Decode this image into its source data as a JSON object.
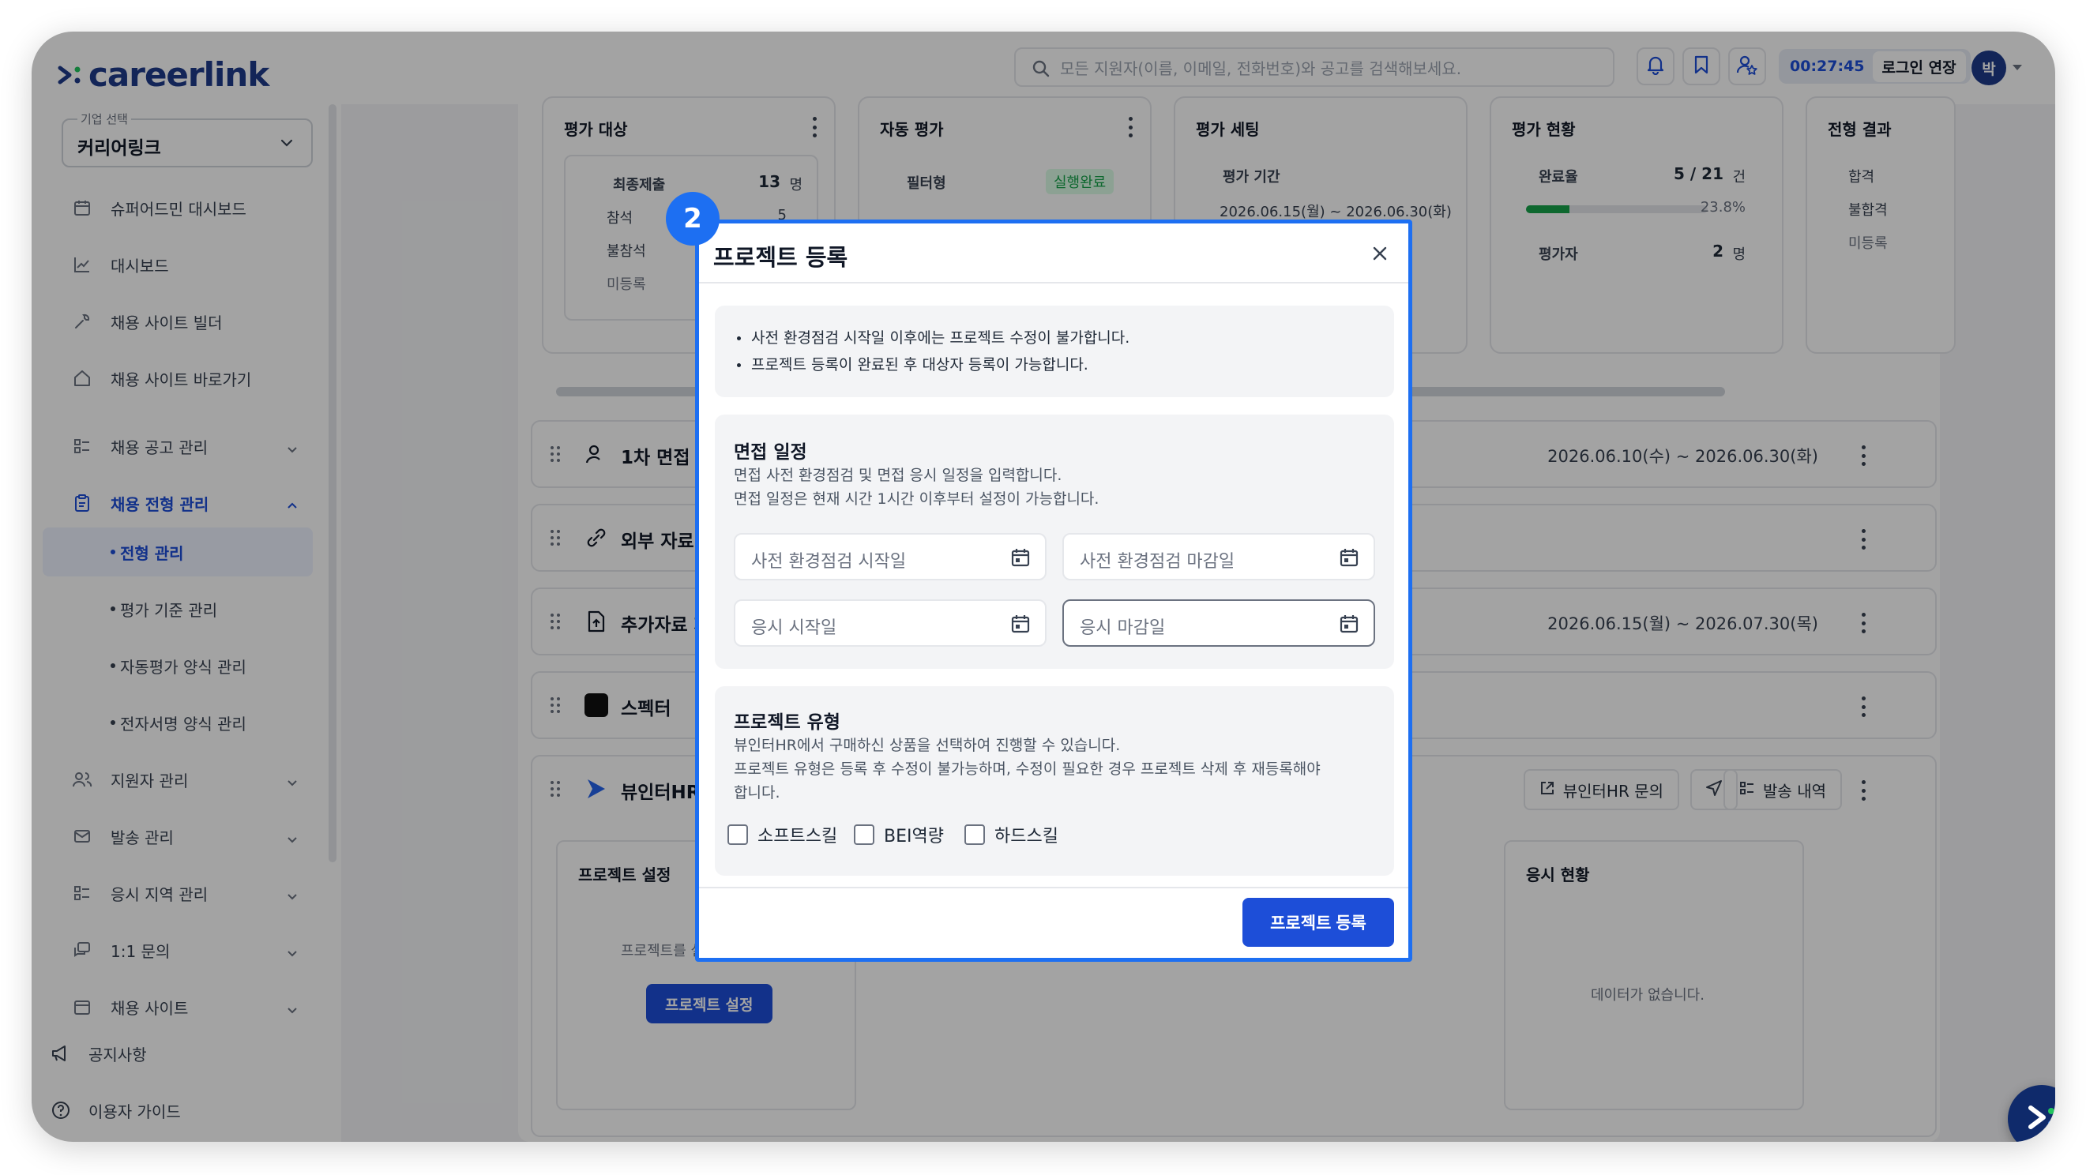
{
  "app": {
    "logo_text": "careerlink"
  },
  "header": {
    "search_placeholder": "모든 지원자(이름, 이메일, 전화번호)와 공고를 검색해보세요.",
    "timer": "00:27:45",
    "extend_label": "로그인 연장",
    "avatar_initial": "박"
  },
  "sidebar": {
    "company_caption": "기업 선택",
    "company_value": "커리어링크",
    "items": [
      {
        "label": "슈퍼어드민 대시보드"
      },
      {
        "label": "대시보드"
      },
      {
        "label": "채용 사이트 빌더"
      },
      {
        "label": "채용 사이트 바로가기"
      },
      {
        "label": "채용 공고 관리"
      },
      {
        "label": "채용 전형 관리"
      },
      {
        "label": "지원자 관리"
      },
      {
        "label": "발송 관리"
      },
      {
        "label": "응시 지역 관리"
      },
      {
        "label": "1:1 문의"
      },
      {
        "label": "채용 사이트"
      }
    ],
    "sub_items": [
      {
        "label": "전형 관리"
      },
      {
        "label": "평가 기준 관리"
      },
      {
        "label": "자동평가 양식 관리"
      },
      {
        "label": "전자서명 양식 관리"
      }
    ],
    "footer": [
      {
        "label": "공지사항"
      },
      {
        "label": "이용자 가이드"
      }
    ]
  },
  "background": {
    "eval_target": {
      "title": "평가 대상",
      "final_submit": "최종제출",
      "final_submit_count": "13",
      "unit": "명",
      "present": "참석",
      "present_count": "5",
      "absent": "불참석",
      "unregistered": "미등록"
    },
    "auto_eval": {
      "title": "자동 평가",
      "filter": "필터형",
      "status": "실행완료"
    },
    "eval_setting": {
      "title": "평가 세팅",
      "period_label": "평가 기간",
      "period": "2026.06.15(월) ~ 2026.06.30(화)"
    },
    "eval_status": {
      "title": "평가 현황",
      "completion": "완료율",
      "completion_value": "5 / 21",
      "completion_unit": "건",
      "percent": "23.8%",
      "progress": 23.8,
      "evaluator": "평가자",
      "evaluator_count": "2",
      "unit": "명"
    },
    "result": {
      "title": "전형 결과",
      "pass": "합격",
      "fail": "불합격",
      "unregistered": "미등록"
    },
    "rows": [
      {
        "title": "1차 면접",
        "date": "2026.06.10(수) ~ 2026.06.30(화)"
      },
      {
        "title": "외부 자료 연동",
        "date": ""
      },
      {
        "title": "추가자료 제출",
        "date": "2026.06.15(월) ~ 2026.07.30(목)"
      },
      {
        "title": "스펙터",
        "date": ""
      },
      {
        "title": "뷰인터HR",
        "date": ""
      }
    ],
    "viewinter": {
      "inquiry": "뷰인터HR 문의",
      "send_history": "발송 내역",
      "project_setting_title": "프로젝트 설정",
      "project_setting_desc": "프로젝트를 설정",
      "project_setting_btn": "프로젝트 설정",
      "exam_status_title": "응시 현황",
      "no_data": "데이터가 없습니다."
    }
  },
  "modal": {
    "step": "2",
    "title": "프로젝트 등록",
    "notices": [
      "사전 환경점검 시작일 이후에는 프로젝트 수정이 불가합니다.",
      "프로젝트 등록이 완료된 후 대상자 등록이 가능합니다."
    ],
    "schedule": {
      "title": "면접 일정",
      "desc1": "면접 사전 환경점검 및 면접 응시 일정을 입력합니다.",
      "desc2": "면접 일정은 현재 시간 1시간 이후부터 설정이 가능합니다.",
      "precheck_start": "사전 환경점검 시작일",
      "precheck_end": "사전 환경점검 마감일",
      "exam_start": "응시 시작일",
      "exam_end": "응시 마감일"
    },
    "type": {
      "title": "프로젝트 유형",
      "desc1": "뷰인터HR에서 구매하신 상품을 선택하여 진행할 수 있습니다.",
      "desc2": "프로젝트 유형은 등록 후 수정이 불가능하며, 수정이 필요한 경우 프로젝트 삭제 후 재등록해야",
      "desc3": "합니다.",
      "options": [
        "소프트스킬",
        "BEI역량",
        "하드스킬"
      ]
    },
    "submit_label": "프로젝트 등록"
  },
  "colors": {
    "accent": "#1d4ed8",
    "highlight": "#1d6ff2",
    "logo": "#1e3a8a"
  }
}
